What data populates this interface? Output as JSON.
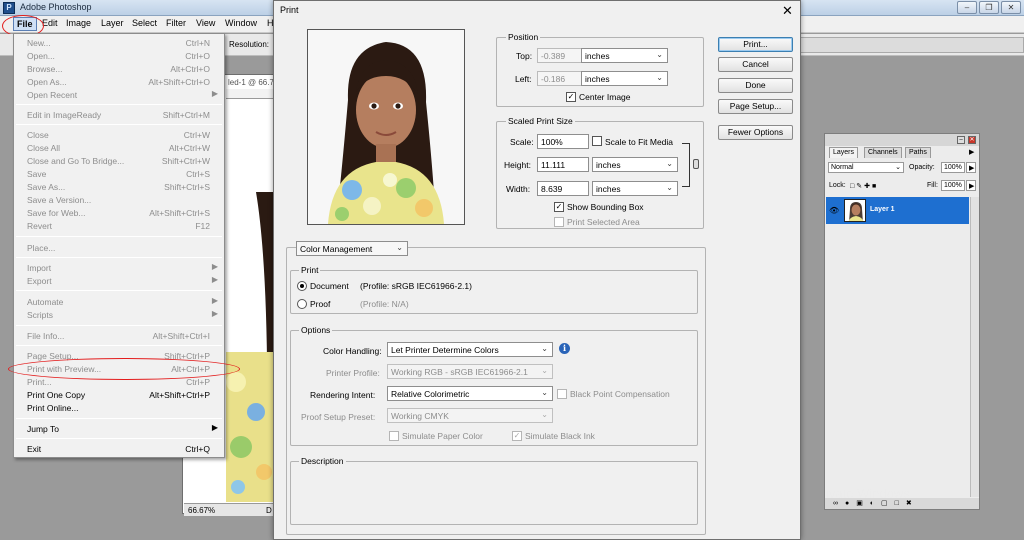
{
  "app": {
    "title": "Adobe Photoshop",
    "window_controls": [
      "minimize-icon",
      "restore-icon",
      "close-icon"
    ]
  },
  "menubar": {
    "items": [
      "File",
      "Edit",
      "Image",
      "Layer",
      "Select",
      "Filter",
      "View",
      "Window",
      "H"
    ]
  },
  "optionsbar": {
    "resolution_label": "Resolution:"
  },
  "document": {
    "tab_title": "led-1 @ 66.7",
    "zoom": "66.67%",
    "status_marker": "D"
  },
  "file_menu": {
    "items": [
      {
        "label": "New...",
        "shortcut": "Ctrl+N"
      },
      {
        "label": "Open...",
        "shortcut": "Ctrl+O"
      },
      {
        "label": "Browse...",
        "shortcut": "Alt+Ctrl+O"
      },
      {
        "label": "Open As...",
        "shortcut": "Alt+Shift+Ctrl+O"
      },
      {
        "label": "Open Recent",
        "shortcut": ""
      },
      {
        "label": "Edit in ImageReady",
        "shortcut": "Shift+Ctrl+M"
      },
      {
        "label": "Close",
        "shortcut": "Ctrl+W"
      },
      {
        "label": "Close All",
        "shortcut": "Alt+Ctrl+W"
      },
      {
        "label": "Close and Go To Bridge...",
        "shortcut": "Shift+Ctrl+W"
      },
      {
        "label": "Save",
        "shortcut": "Ctrl+S"
      },
      {
        "label": "Save As...",
        "shortcut": "Shift+Ctrl+S"
      },
      {
        "label": "Save a Version...",
        "shortcut": ""
      },
      {
        "label": "Save for Web...",
        "shortcut": "Alt+Shift+Ctrl+S"
      },
      {
        "label": "Revert",
        "shortcut": "F12"
      },
      {
        "label": "Place...",
        "shortcut": ""
      },
      {
        "label": "Import",
        "shortcut": ""
      },
      {
        "label": "Export",
        "shortcut": ""
      },
      {
        "label": "Automate",
        "shortcut": ""
      },
      {
        "label": "Scripts",
        "shortcut": ""
      },
      {
        "label": "File Info...",
        "shortcut": "Alt+Shift+Ctrl+I"
      },
      {
        "label": "Page Setup...",
        "shortcut": "Shift+Ctrl+P"
      },
      {
        "label": "Print with Preview...",
        "shortcut": "Alt+Ctrl+P"
      },
      {
        "label": "Print...",
        "shortcut": "Ctrl+P"
      },
      {
        "label": "Print One Copy",
        "shortcut": "Alt+Shift+Ctrl+P"
      },
      {
        "label": "Print Online...",
        "shortcut": ""
      },
      {
        "label": "Jump To",
        "shortcut": ""
      },
      {
        "label": "Exit",
        "shortcut": "Ctrl+Q"
      }
    ]
  },
  "print_dialog": {
    "title": "Print",
    "buttons": {
      "print": "Print...",
      "cancel": "Cancel",
      "done": "Done",
      "page_setup": "Page Setup...",
      "fewer_options": "Fewer Options"
    },
    "position": {
      "title": "Position",
      "top_label": "Top:",
      "top_value": "-0.389",
      "top_unit": "inches",
      "left_label": "Left:",
      "left_value": "-0.186",
      "left_unit": "inches",
      "center_image": "Center Image",
      "center_checked": true
    },
    "scaled": {
      "title": "Scaled Print Size",
      "scale_label": "Scale:",
      "scale_value": "100%",
      "scale_to_fit": "Scale to Fit Media",
      "height_label": "Height:",
      "height_value": "11.111",
      "height_unit": "inches",
      "width_label": "Width:",
      "width_value": "8.639",
      "width_unit": "inches",
      "show_bbox": "Show Bounding Box",
      "bbox_checked": true,
      "print_selected": "Print Selected Area"
    },
    "color_mgmt": {
      "dropdown": "Color Management",
      "print_group": "Print",
      "document_label": "Document",
      "document_profile": "(Profile: sRGB IEC61966-2.1)",
      "proof_label": "Proof",
      "proof_profile": "(Profile: N/A)",
      "options_group": "Options",
      "color_handling_label": "Color Handling:",
      "color_handling_value": "Let Printer Determine Colors",
      "printer_profile_label": "Printer Profile:",
      "printer_profile_value": "Working RGB - sRGB IEC61966-2.1",
      "rendering_intent_label": "Rendering Intent:",
      "rendering_intent_value": "Relative Colorimetric",
      "bpc_label": "Black Point Compensation",
      "proof_preset_label": "Proof Setup Preset:",
      "proof_preset_value": "Working CMYK",
      "simulate_paper": "Simulate Paper Color",
      "simulate_black": "Simulate Black Ink",
      "description_group": "Description"
    }
  },
  "layers_panel": {
    "tabs": [
      "Layers",
      "Channels",
      "Paths"
    ],
    "blend_mode": "Normal",
    "opacity_label": "Opacity:",
    "opacity_value": "100%",
    "lock_label": "Lock:",
    "fill_label": "Fill:",
    "fill_value": "100%",
    "layer_name": "Layer 1"
  },
  "watermark": "ivate Windows",
  "colors": {
    "accent": "#1e6fd0",
    "highlight_red": "#e31c1c"
  }
}
